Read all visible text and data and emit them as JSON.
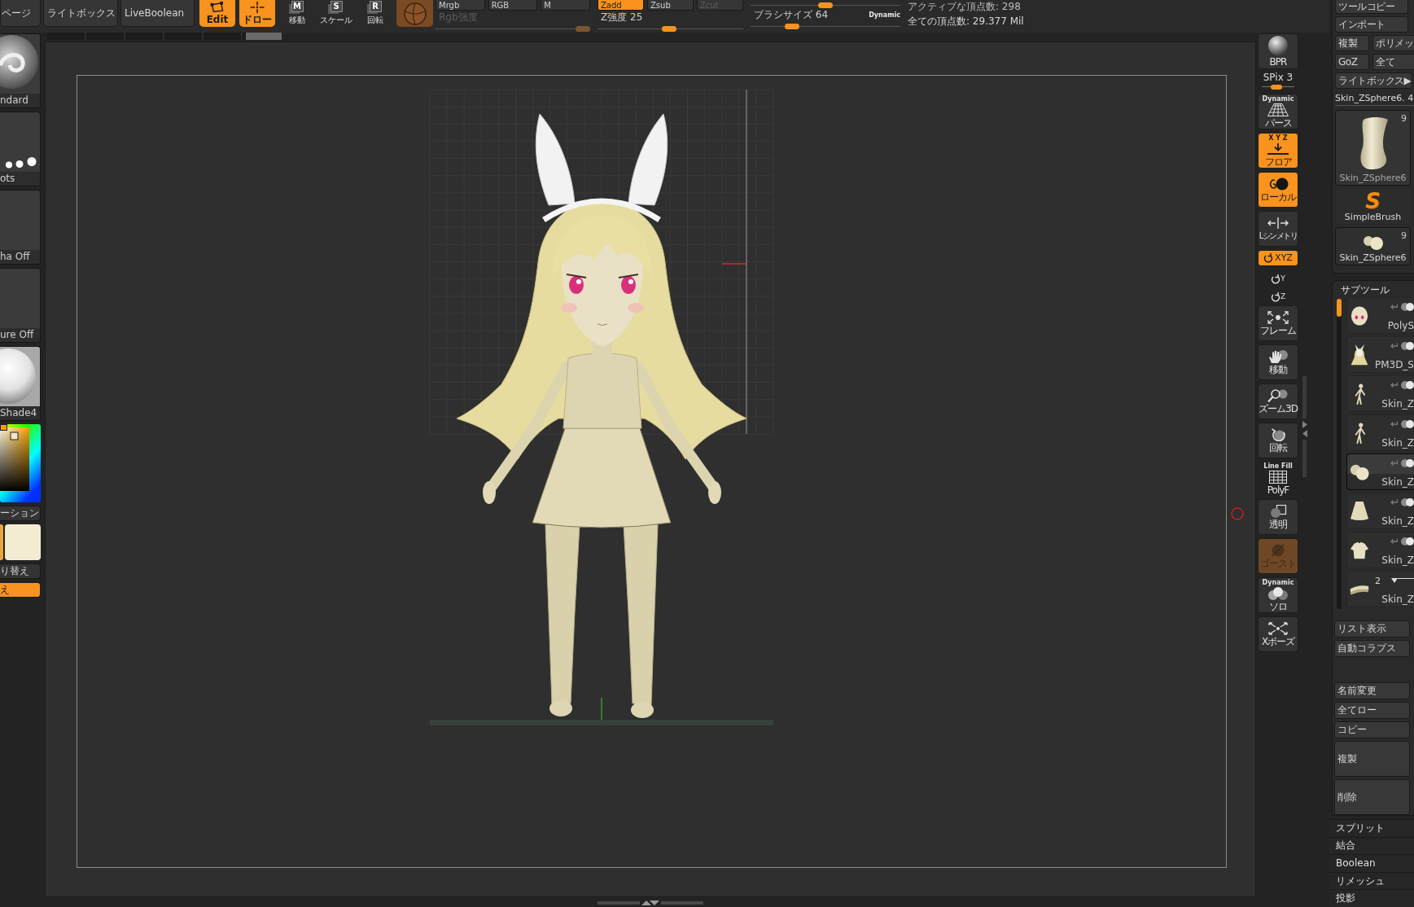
{
  "top_bar": {
    "menu_buttons": [
      {
        "label": "ページ"
      },
      {
        "label": "ライトボックス"
      },
      {
        "label": "LiveBoolean"
      }
    ],
    "mode_buttons": [
      {
        "kind": "edit",
        "label": "Edit",
        "selected": true
      },
      {
        "kind": "draw",
        "label": "ドロー",
        "selected": true
      }
    ],
    "transform_buttons": [
      {
        "key": "M",
        "label": "移動"
      },
      {
        "key": "S",
        "label": "スケール"
      },
      {
        "key": "R",
        "label": "回転"
      }
    ],
    "sections": [
      {
        "buttons": [
          {
            "label": "Mrgb",
            "selected": false,
            "disabled": false
          },
          {
            "label": "RGB",
            "selected": false,
            "disabled": false
          },
          {
            "label": "M",
            "selected": false,
            "disabled": false
          }
        ],
        "slider": {
          "label": "Rgb強度",
          "level": 1.0,
          "disabled": true
        }
      },
      {
        "buttons": [
          {
            "label": "Zadd",
            "selected": true,
            "disabled": false
          },
          {
            "label": "Zsub",
            "selected": false,
            "disabled": false
          },
          {
            "label": "Zcut",
            "selected": false,
            "disabled": true
          }
        ],
        "slider": {
          "label": "Z強度",
          "value": "25",
          "level": 0.49,
          "disabled": false
        }
      }
    ],
    "brush_sliders": [
      {
        "level": 0.5,
        "disabled": false
      },
      {
        "label": "ブラシサイズ",
        "value": "64",
        "badge": "Dynamic",
        "level": 0.25,
        "disabled": false
      }
    ],
    "stats": [
      "アクティブな頂点数: 298",
      "全ての頂点数: 29.377 Mil"
    ]
  },
  "left_panel": {
    "tiles": [
      {
        "kind": "brush",
        "label": "ndard"
      },
      {
        "kind": "stroke",
        "label": "ots"
      },
      {
        "kind": "alpha",
        "label": "ha Off"
      },
      {
        "kind": "texture",
        "label": "ure Off"
      },
      {
        "kind": "material",
        "label": "Shade4"
      }
    ],
    "gradient_button": {
      "label": "ーション"
    },
    "swatches": [
      {
        "color": "#e9a83a"
      },
      {
        "color": "#f4ebd3"
      }
    ],
    "switch_button": {
      "label": "り替え"
    },
    "fill_button": {
      "label": "え",
      "on": true
    }
  },
  "view_tools": [
    {
      "kind": "bpr",
      "label": "BPR",
      "on": false,
      "disabled": false
    },
    {
      "kind": "slider",
      "label": "SPix 3",
      "level": 0.43
    },
    {
      "kind": "perspective",
      "top_label": "Dynamic",
      "label": "パース",
      "on": false,
      "disabled": false
    },
    {
      "kind": "floor",
      "top_label": "X Y Z",
      "label": "フロア",
      "on": true,
      "disabled": false
    },
    {
      "kind": "local",
      "label": "ローカル",
      "on": true,
      "disabled": false
    },
    {
      "kind": "symmetry",
      "label": "Lシンメトリ",
      "on": false,
      "disabled": false
    },
    {
      "kind": "rotate_xyz",
      "label": "XYZ",
      "on": true,
      "disabled": false
    },
    {
      "kind": "rotate_y",
      "label": "Y",
      "on": false,
      "disabled": false
    },
    {
      "kind": "rotate_z",
      "label": "Z",
      "on": false,
      "disabled": false
    },
    {
      "kind": "frame",
      "label": "フレーム",
      "on": false,
      "disabled": false
    },
    {
      "kind": "move",
      "label": "移動",
      "on": false,
      "disabled": false
    },
    {
      "kind": "zoom",
      "label": "ズーム3D",
      "on": false,
      "disabled": false
    },
    {
      "kind": "rotate",
      "label": "回転",
      "on": false,
      "disabled": false
    },
    {
      "kind": "polyf",
      "top_label": "Line Fill",
      "label": "PolyF",
      "on": false,
      "disabled": false
    },
    {
      "kind": "transparent",
      "label": "透明",
      "on": false,
      "disabled": false
    },
    {
      "kind": "ghost",
      "label": "ゴースト",
      "on": true,
      "disabled": true
    },
    {
      "kind": "solo",
      "top_label": "Dynamic",
      "label": "ソロ",
      "on": false,
      "disabled": false
    },
    {
      "kind": "xpose",
      "label": "Xポーズ",
      "on": false,
      "disabled": false
    }
  ],
  "tool_palette": {
    "rows": [
      [
        {
          "label": "ツールコピー"
        }
      ],
      [
        {
          "label": "インポート"
        }
      ],
      [
        {
          "label": "複製"
        },
        {
          "label": "ポリメッ"
        }
      ],
      [
        {
          "label": "GoZ"
        },
        {
          "label": "全て"
        }
      ],
      [
        {
          "label": "ライトボックス▶"
        }
      ]
    ],
    "current_tool": "Skin_ZSphere6. 4",
    "thumbnails": [
      {
        "kind": "tube",
        "count": "9",
        "label": "Skin_ZSphere6"
      },
      {
        "kind": "logo",
        "logo": "S",
        "label": "SimpleBrush"
      },
      {
        "kind": "blob",
        "count": "9",
        "label": "Skin_ZSphere6"
      }
    ]
  },
  "subtools": {
    "title": "サブツール",
    "items": [
      {
        "kind": "head",
        "name": "PolyS",
        "selected": false
      },
      {
        "kind": "hair",
        "name": "PM3D_S",
        "selected": false
      },
      {
        "kind": "figure",
        "name": "Skin_Z",
        "selected": false
      },
      {
        "kind": "figure",
        "name": "Skin_Z",
        "selected": false
      },
      {
        "kind": "blob",
        "name": "Skin_Z",
        "selected": true
      },
      {
        "kind": "skirt",
        "name": "Skin_Z",
        "selected": false
      },
      {
        "kind": "shirt",
        "name": "Skin_Z",
        "selected": false
      },
      {
        "kind": "belt",
        "name": "Skin_Z",
        "count": "2",
        "selected": false
      }
    ],
    "list_buttons": [
      {
        "label": "リスト表示"
      },
      {
        "label": "自動コラプス"
      }
    ],
    "edit_buttons": [
      {
        "kind": "short",
        "label": "名前変更"
      },
      {
        "kind": "short",
        "label": "全てロー"
      },
      {
        "kind": "short",
        "label": "コピー"
      },
      {
        "kind": "tall",
        "label": "複製"
      },
      {
        "kind": "tall",
        "label": "削除"
      }
    ]
  },
  "sections": [
    {
      "label": "スプリット"
    },
    {
      "label": "結合"
    },
    {
      "label": "Boolean"
    },
    {
      "label": "リメッシュ"
    },
    {
      "label": "投影"
    }
  ]
}
